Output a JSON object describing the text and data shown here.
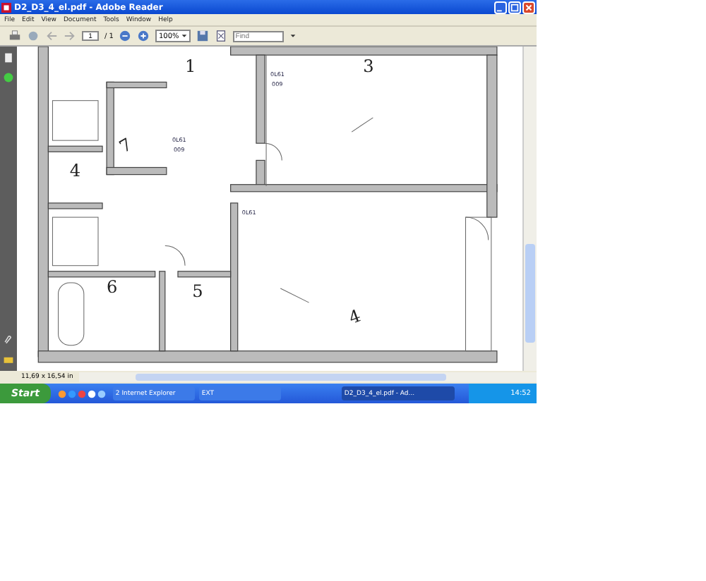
{
  "window": {
    "title": "D2_D3_4_el.pdf - Adobe Reader"
  },
  "menu": [
    "File",
    "Edit",
    "View",
    "Document",
    "Tools",
    "Window",
    "Help"
  ],
  "toolbar": {
    "page": "1",
    "page_total": "/ 1",
    "zoom": "100%",
    "find": {
      "placeholder": "Find"
    }
  },
  "document": {
    "labels": [
      {
        "text": "1",
        "kind": "room"
      },
      {
        "text": "3",
        "kind": "room"
      },
      {
        "text": "7",
        "kind": "room"
      },
      {
        "text": "4",
        "kind": "room"
      },
      {
        "text": "6",
        "kind": "room"
      },
      {
        "text": "5",
        "kind": "room"
      },
      {
        "text": "4",
        "kind": "room"
      },
      {
        "text": "0L61",
        "kind": "tag"
      },
      {
        "text": "009",
        "kind": "tag"
      },
      {
        "text": "0L61",
        "kind": "tag"
      },
      {
        "text": "009",
        "kind": "tag"
      },
      {
        "text": "0L61",
        "kind": "tag"
      }
    ]
  },
  "status_bar": {
    "page_size": "11,69 x 16,54 in"
  },
  "taskbar": {
    "start": "Start",
    "tasks": [
      {
        "label": "2 Internet Explorer",
        "selected": false
      },
      {
        "label": "EXT",
        "selected": false
      },
      {
        "label": "D2_D3_4_el.pdf - Ad...",
        "selected": true
      }
    ],
    "clock": "14:52"
  }
}
